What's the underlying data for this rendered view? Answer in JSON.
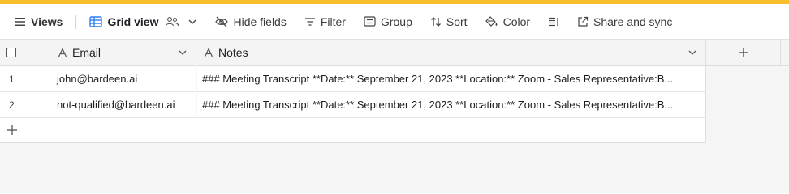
{
  "toolbar": {
    "views_label": "Views",
    "grid_view_label": "Grid view",
    "hide_fields_label": "Hide fields",
    "filter_label": "Filter",
    "group_label": "Group",
    "sort_label": "Sort",
    "color_label": "Color",
    "share_label": "Share and sync"
  },
  "columns": {
    "email": "Email",
    "notes": "Notes"
  },
  "rows": [
    {
      "num": "1",
      "email": "john@bardeen.ai",
      "notes": "### Meeting Transcript **Date:** September 21, 2023 **Location:** Zoom - Sales Representative:B..."
    },
    {
      "num": "2",
      "email": "not-qualified@bardeen.ai",
      "notes": "### Meeting Transcript **Date:** September 21, 2023 **Location:** Zoom - Sales Representative:B..."
    }
  ],
  "colors": {
    "accent_bar": "#f8bd2b",
    "grid_icon": "#2d7ff9"
  },
  "icons": [
    "hamburger-icon",
    "grid-icon",
    "people-icon",
    "chevron-down-icon",
    "eye-slash-icon",
    "filter-icon",
    "group-icon",
    "sort-icon",
    "paint-bucket-icon",
    "row-height-icon",
    "share-icon",
    "text-field-icon",
    "plus-icon"
  ]
}
